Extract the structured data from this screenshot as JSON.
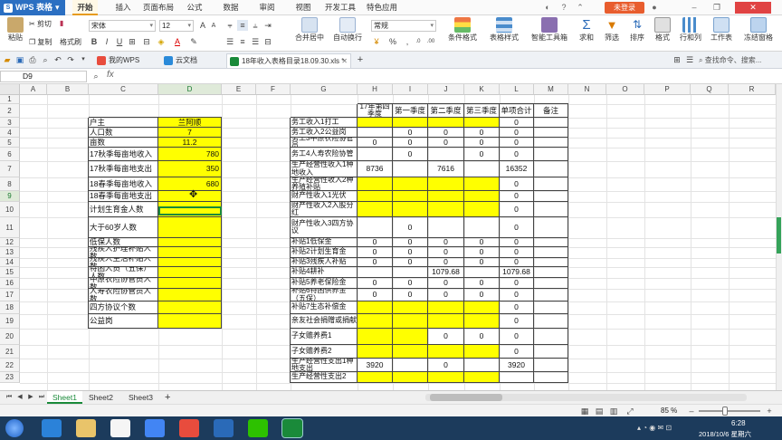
{
  "app": {
    "name": "WPS 表格",
    "login_label": "未登录"
  },
  "ribbon_tabs": [
    "开始",
    "插入",
    "页面布局",
    "公式",
    "数据",
    "审阅",
    "视图",
    "开发工具",
    "特色应用"
  ],
  "active_ribbon_tab": "开始",
  "ribbon": {
    "paste": "粘贴",
    "cut": "剪切",
    "copy": "复制",
    "format_painter": "格式刷",
    "font_name": "宋体",
    "font_size": "12",
    "merge_center": "合并居中",
    "auto_wrap": "自动换行",
    "number_format": "常规",
    "conditional_format": "条件格式",
    "table_style": "表格样式",
    "smart_toolbox": "智能工具箱",
    "sum": "求和",
    "filter": "筛选",
    "sort": "排序",
    "format": "格式",
    "row_col": "行和列",
    "worksheet": "工作表",
    "freeze_pane": "冻结窗格"
  },
  "doc_tabs": [
    {
      "label": "我的WPS",
      "icon": "wps-home-icon"
    },
    {
      "label": "云文档",
      "icon": "cloud-doc-icon"
    },
    {
      "label": "18年收入表格目录18.09.30.xls *",
      "icon": "spreadsheet-file-icon",
      "active": true
    }
  ],
  "command_search_placeholder": "查找命令、搜索...",
  "formula_bar": {
    "cell_ref": "D9",
    "fx_label": "fx",
    "value": ""
  },
  "columns": [
    "A",
    "B",
    "C",
    "D",
    "E",
    "F",
    "G",
    "H",
    "I",
    "J",
    "K",
    "L",
    "M",
    "N",
    "O",
    "P",
    "Q",
    "R"
  ],
  "rows": [
    "1",
    "2",
    "3",
    "4",
    "5",
    "6",
    "7",
    "8",
    "9",
    "10",
    "11",
    "12",
    "13",
    "14",
    "15",
    "16",
    "17",
    "18",
    "19",
    "20",
    "21",
    "22",
    "23"
  ],
  "left_table": [
    {
      "label": "户主",
      "value": "兰阿顺",
      "align": "c"
    },
    {
      "label": "人口数",
      "value": "7",
      "align": "c"
    },
    {
      "label": "亩数",
      "value": "11.2",
      "align": "c"
    },
    {
      "label": "17秋季每亩地收入",
      "value": "780",
      "align": "r"
    },
    {
      "label": "17秋季每亩地支出",
      "value": "350",
      "align": "r"
    },
    {
      "label": "18春季每亩地收入",
      "value": "680",
      "align": "r"
    },
    {
      "label": "18春季每亩地支出",
      "value": "",
      "align": "r"
    },
    {
      "label": "计划生育金人数",
      "value": "",
      "align": "r"
    },
    {
      "label": "大于60岁人数",
      "value": "",
      "align": "r"
    },
    {
      "label": "低保人数",
      "value": "",
      "align": "r"
    },
    {
      "label": "残疾人护理补贴人数",
      "value": "",
      "align": "r"
    },
    {
      "label": "残疾人生活补贴人数",
      "value": "",
      "align": "r"
    },
    {
      "label": "特困人员（五保）人数",
      "value": "",
      "align": "r"
    },
    {
      "label": "中原农险协管员人数",
      "value": "",
      "align": "r"
    },
    {
      "label": "人寿农险协管员人数",
      "value": "",
      "align": "r"
    },
    {
      "label": "四方协议个数",
      "value": "",
      "align": "r"
    },
    {
      "label": "公益岗",
      "value": "",
      "align": "r"
    }
  ],
  "right_table": {
    "headers": [
      "17年第四季度",
      "第一季度",
      "第二季度",
      "第三季度",
      "单项合计",
      "备注"
    ],
    "rows": [
      {
        "label": "务工收入1打工",
        "v": [
          "",
          "",
          "",
          "",
          "0"
        ],
        "y": [
          true,
          true,
          true,
          true,
          false
        ]
      },
      {
        "label": "务工收入2公益岗",
        "v": [
          "",
          "0",
          "0",
          "0",
          "0"
        ],
        "y": [
          false,
          false,
          false,
          false,
          false
        ]
      },
      {
        "label": "务工3中原农险协管员",
        "v": [
          "0",
          "0",
          "0",
          "0",
          "0"
        ],
        "y": [
          false,
          false,
          false,
          false,
          false
        ]
      },
      {
        "label": "务工4人寿农险协管",
        "v": [
          "",
          "0",
          "",
          "0",
          "0"
        ],
        "y": [
          false,
          false,
          false,
          false,
          false
        ]
      },
      {
        "label": "生产经营性收入1种地收入",
        "v": [
          "8736",
          "",
          "7616",
          "",
          "16352"
        ],
        "y": [
          false,
          false,
          false,
          false,
          false
        ]
      },
      {
        "label": "生产经营性收入2种养殖补贴",
        "v": [
          "",
          "",
          "",
          "",
          "0"
        ],
        "y": [
          true,
          true,
          true,
          true,
          false
        ]
      },
      {
        "label": "财产性收入1光伏",
        "v": [
          "",
          "",
          "",
          "",
          "0"
        ],
        "y": [
          true,
          true,
          true,
          true,
          false
        ]
      },
      {
        "label": "财产性收入2入股分红",
        "v": [
          "",
          "",
          "",
          "",
          "0"
        ],
        "y": [
          true,
          true,
          true,
          true,
          false
        ]
      },
      {
        "label": "财产性收入3四方协议",
        "v": [
          "",
          "0",
          "",
          "",
          "0"
        ],
        "y": [
          false,
          false,
          false,
          false,
          false
        ]
      },
      {
        "label": "补贴1低保金",
        "v": [
          "0",
          "0",
          "0",
          "0",
          "0"
        ],
        "y": [
          false,
          false,
          false,
          false,
          false
        ]
      },
      {
        "label": "补贴2计划生育金",
        "v": [
          "0",
          "0",
          "0",
          "0",
          "0"
        ],
        "y": [
          false,
          false,
          false,
          false,
          false
        ]
      },
      {
        "label": "补贴3残疾人补贴",
        "v": [
          "0",
          "0",
          "0",
          "0",
          "0"
        ],
        "y": [
          false,
          false,
          false,
          false,
          false
        ]
      },
      {
        "label": "补贴4耕补",
        "v": [
          "",
          "",
          "1079.68",
          "",
          "1079.68"
        ],
        "y": [
          false,
          false,
          false,
          false,
          false
        ]
      },
      {
        "label": "补贴5养老保险金",
        "v": [
          "0",
          "0",
          "0",
          "0",
          "0"
        ],
        "y": [
          false,
          false,
          false,
          false,
          false
        ]
      },
      {
        "label": "补贴6特困供养金（五保）",
        "v": [
          "0",
          "0",
          "0",
          "0",
          "0"
        ],
        "y": [
          false,
          false,
          false,
          false,
          false
        ]
      },
      {
        "label": "补贴7生态补偿金",
        "v": [
          "",
          "",
          "",
          "",
          "0"
        ],
        "y": [
          true,
          true,
          true,
          true,
          false
        ]
      },
      {
        "label": "亲友社会捐赠或捐献",
        "v": [
          "",
          "",
          "",
          "",
          "0"
        ],
        "y": [
          true,
          true,
          true,
          true,
          false
        ]
      },
      {
        "label": "子女赡养费1",
        "v": [
          "",
          "",
          "0",
          "0",
          "0"
        ],
        "y": [
          true,
          true,
          false,
          false,
          false
        ]
      },
      {
        "label": "子女赡养费2",
        "v": [
          "",
          "",
          "",
          "",
          "0"
        ],
        "y": [
          true,
          true,
          true,
          true,
          false
        ]
      },
      {
        "label": "生产经营性支出1种地支出",
        "v": [
          "3920",
          "",
          "0",
          "",
          "3920"
        ],
        "y": [
          false,
          false,
          false,
          false,
          false
        ]
      },
      {
        "label": "生产经营性支出2",
        "v": [
          "",
          "",
          "",
          "",
          ""
        ],
        "y": [
          true,
          true,
          true,
          true,
          false
        ]
      }
    ]
  },
  "sheet_tabs": [
    "Sheet1",
    "Sheet2",
    "Sheet3"
  ],
  "active_sheet": "Sheet1",
  "add_sheet_label": "+",
  "status": {
    "zoom": "85 %"
  },
  "taskbar": {
    "time": "6:28",
    "date": "2018/10/6 星期六"
  },
  "colors": {
    "yellow_fill": "#ffff00",
    "accent_green": "#1a8a3a",
    "app_blue": "#2b6fc2",
    "login_orange": "#e85d2e"
  }
}
